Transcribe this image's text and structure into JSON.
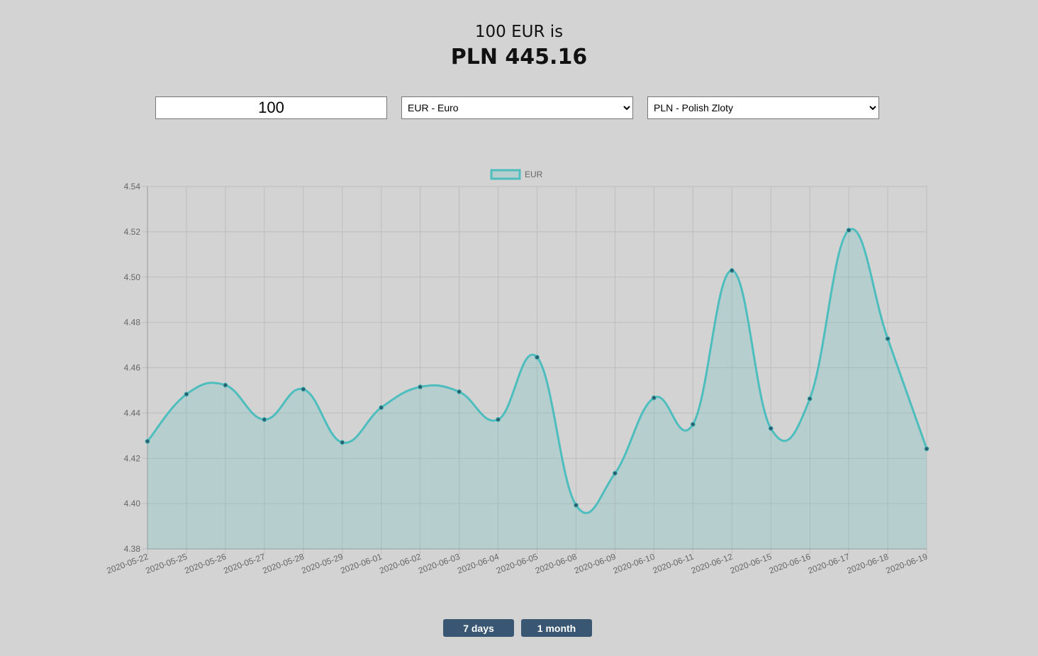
{
  "converter": {
    "result_line1": "100 EUR is",
    "result_line2": "PLN 445.16",
    "amount_value": "100",
    "from_currency": "EUR - Euro",
    "to_currency": "PLN - Polish Zloty"
  },
  "buttons": {
    "seven_days": "7 days",
    "one_month": "1 month"
  },
  "colors": {
    "line": "#4dbdbd",
    "fill": "rgba(77,189,189,0.2)",
    "point": "#2a5f70",
    "grid": "#bdbdbd",
    "button": "#395773",
    "background": "#d3d3d3"
  },
  "chart_data": {
    "type": "area",
    "legend": [
      "EUR"
    ],
    "legend_position": "top-center",
    "grid": true,
    "x": [
      "2020-05-22",
      "2020-05-25",
      "2020-05-26",
      "2020-05-27",
      "2020-05-28",
      "2020-05-29",
      "2020-06-01",
      "2020-06-02",
      "2020-06-03",
      "2020-06-04",
      "2020-06-05",
      "2020-06-08",
      "2020-06-09",
      "2020-06-10",
      "2020-06-11",
      "2020-06-12",
      "2020-06-15",
      "2020-06-16",
      "2020-06-17",
      "2020-06-18",
      "2020-06-19"
    ],
    "series": [
      {
        "name": "EUR",
        "values": [
          4.4275,
          4.4483,
          4.4523,
          4.4371,
          4.4505,
          4.427,
          4.4424,
          4.4515,
          4.4494,
          4.4371,
          4.4646,
          4.3993,
          4.4134,
          4.4467,
          4.435,
          4.5029,
          4.4332,
          4.4463,
          4.5207,
          4.4728,
          4.4242
        ]
      }
    ],
    "ylim": [
      4.38,
      4.54
    ],
    "yticks": [
      "4.54",
      "4.52",
      "4.50",
      "4.48",
      "4.46",
      "4.44",
      "4.42",
      "4.40",
      "4.38"
    ]
  }
}
